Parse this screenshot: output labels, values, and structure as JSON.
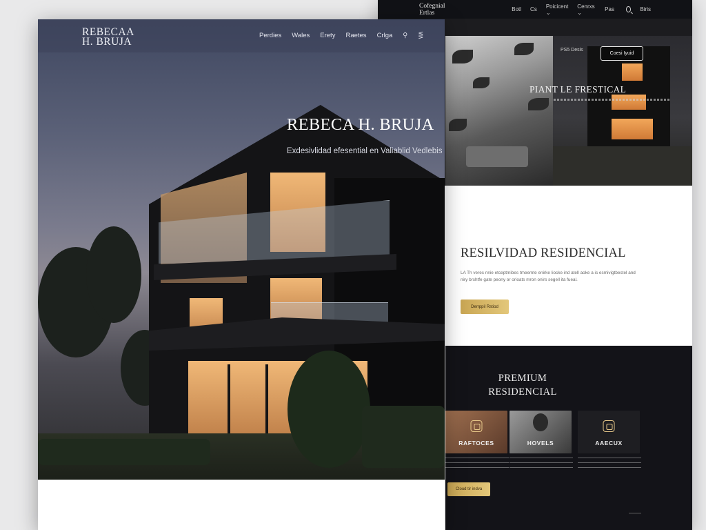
{
  "right_site": {
    "brand": "Cofegnial Ertlas",
    "nav_items": [
      "Botl",
      "Cs",
      "Poicicent",
      "Cenrxs",
      "Pas",
      "Biris"
    ],
    "nav_dropdown_marks": [
      "",
      "",
      "⌄",
      "⌄",
      "",
      ""
    ],
    "secondary_link": "PS5 Desis",
    "contact_button": "Coesi Iyuid",
    "hero_title": "PIANT LE FRESTICAL",
    "section_title": "RESILVIDAD RESIDENCIAL",
    "section_text": "LA Th veres nnie etceptmibes tmeemte enirke liocke ind atell aoke a is esmivigtbestel and niry brshtfe gate peony or orioats mron onirs segell ita fueal.",
    "section_button": "Derrppil Rstiod",
    "premium_title": "PREMIUM RESIDENCIAL",
    "cards": [
      {
        "label": "RAFTOCES",
        "icon": "frame-icon"
      },
      {
        "label": "HOVELS",
        "icon": "portrait-icon"
      },
      {
        "label": "AAECUX",
        "icon": "frame-icon"
      }
    ],
    "dark_button": "Cloud tir indva"
  },
  "left_site": {
    "brand_line1": "REBECAA",
    "brand_line2": "H. BRUJA",
    "nav_items": [
      "Perdies",
      "Wales",
      "Erety",
      "Raetes",
      "Crlga"
    ],
    "hero_title": "REBECA H. BRUJA",
    "hero_subtitle": "Exdesivlidad efesential en Valiablid Vedlebis"
  },
  "colors": {
    "gold_accent": "#d7b864",
    "dark_bg": "#131318",
    "hero_sky": "#5b6178"
  }
}
